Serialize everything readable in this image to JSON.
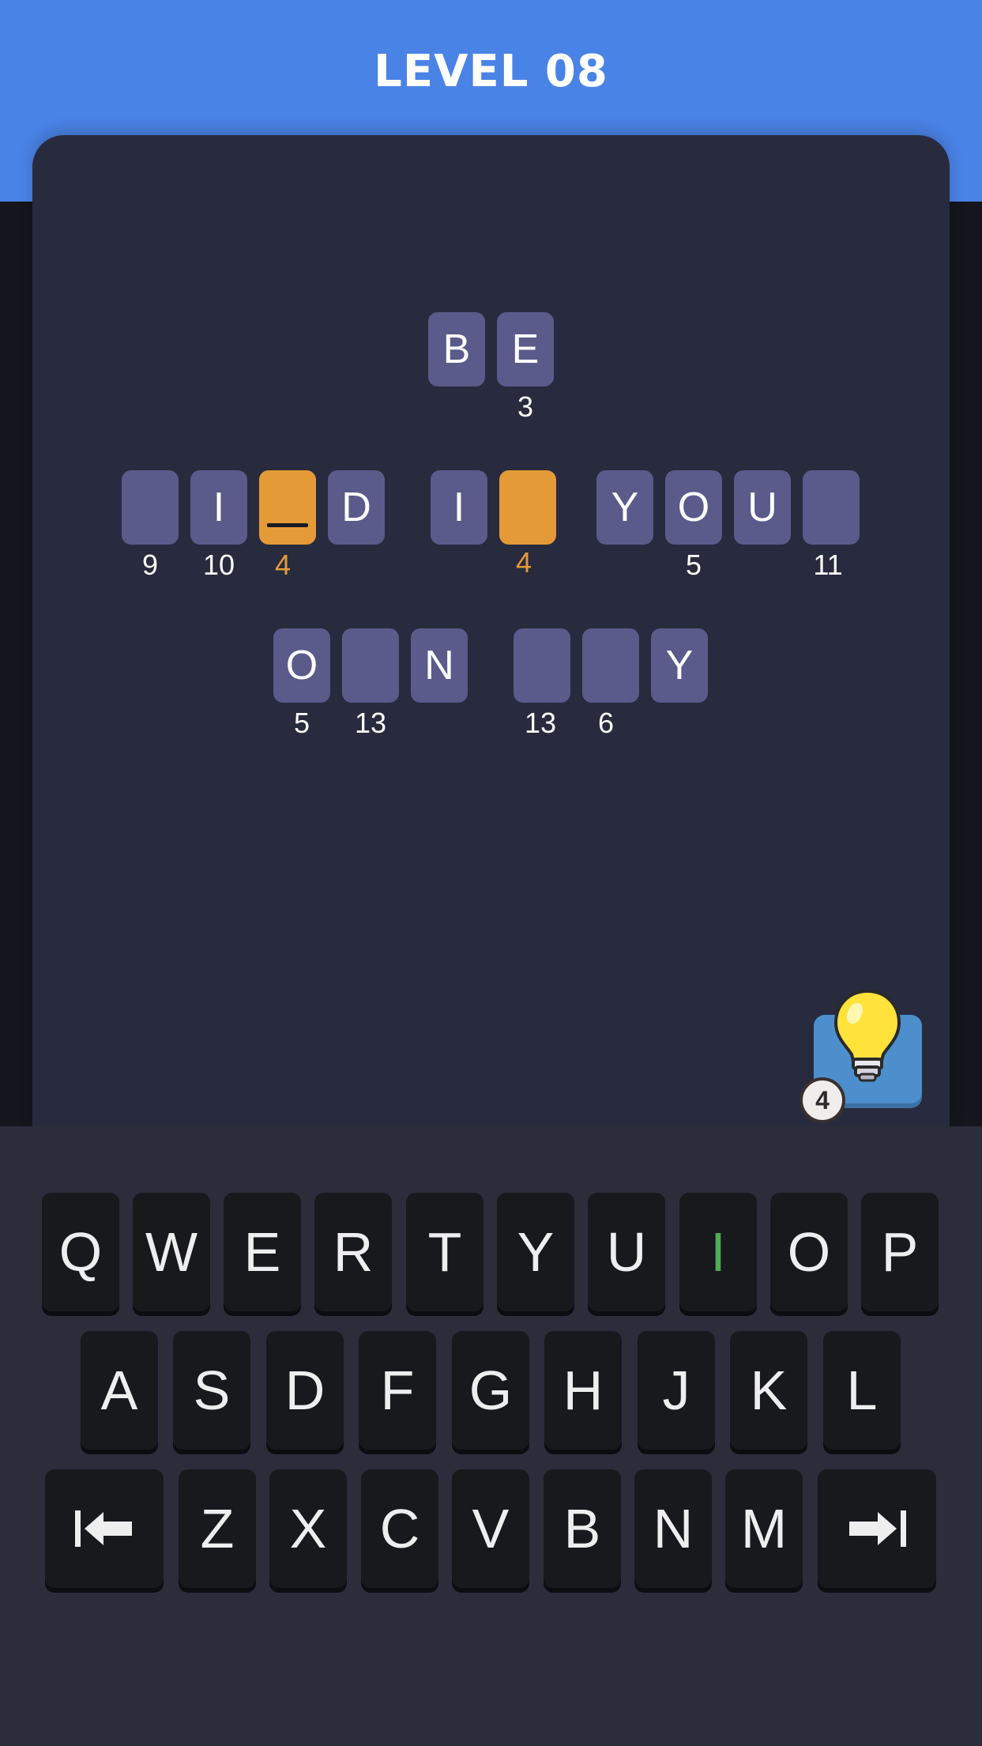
{
  "header": {
    "title": "LEVEL 08"
  },
  "puzzle": {
    "line1": [
      {
        "letter": "B",
        "number": ""
      },
      {
        "letter": "E",
        "number": "3"
      }
    ],
    "line2": [
      {
        "letter": "",
        "number": "9"
      },
      {
        "letter": "I",
        "number": "10"
      },
      {
        "letter": "",
        "number": "4",
        "selected": true,
        "cursor": true
      },
      {
        "letter": "D",
        "number": ""
      },
      {
        "letter": "I",
        "number": ""
      },
      {
        "letter": "",
        "number": "4",
        "selected": true
      },
      {
        "letter": "Y",
        "number": ""
      },
      {
        "letter": "O",
        "number": "5"
      },
      {
        "letter": "U",
        "number": ""
      },
      {
        "letter": "",
        "number": "11"
      }
    ],
    "line3": [
      {
        "letter": "O",
        "number": "5"
      },
      {
        "letter": "",
        "number": "13"
      },
      {
        "letter": "N",
        "number": ""
      },
      {
        "letter": "",
        "number": "13"
      },
      {
        "letter": "",
        "number": "6"
      },
      {
        "letter": "Y",
        "number": ""
      }
    ]
  },
  "hint": {
    "icon": "lightbulb-icon",
    "count": "4"
  },
  "keyboard": {
    "row1": [
      "Q",
      "W",
      "E",
      "R",
      "T",
      "Y",
      "U",
      "I",
      "O",
      "P"
    ],
    "row2": [
      "A",
      "S",
      "D",
      "F",
      "G",
      "H",
      "J",
      "K",
      "L"
    ],
    "row3": [
      "Z",
      "X",
      "C",
      "V",
      "B",
      "N",
      "M"
    ],
    "used_key": "I",
    "left_icon": "arrow-left-bar-icon",
    "right_icon": "arrow-right-bar-icon"
  },
  "colors": {
    "header": "#4a83e6",
    "board": "#282a3e",
    "tile": "#5a5b8b",
    "selected_tile": "#e59a38",
    "used_key": "#4caf50"
  }
}
